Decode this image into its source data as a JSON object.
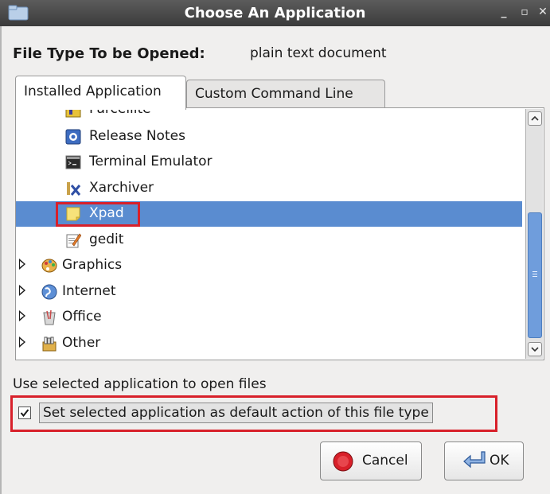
{
  "window": {
    "title": "Choose An Application",
    "minimize_glyph": "_",
    "maximize_glyph": "▫",
    "close_glyph": "✕"
  },
  "file_type": {
    "label": "File Type To be Opened:",
    "value": "plain text document"
  },
  "tabs": [
    {
      "label": "Installed Application",
      "active": true
    },
    {
      "label": "Custom Command Line",
      "active": false
    }
  ],
  "app_list": {
    "items": [
      {
        "label": "Parcellite",
        "icon": "parcellite-icon",
        "kind": "app"
      },
      {
        "label": "Release Notes",
        "icon": "release-notes-icon",
        "kind": "app"
      },
      {
        "label": "Terminal Emulator",
        "icon": "terminal-icon",
        "kind": "app"
      },
      {
        "label": "Xarchiver",
        "icon": "xarchiver-icon",
        "kind": "app"
      },
      {
        "label": "Xpad",
        "icon": "xpad-icon",
        "kind": "app",
        "selected": true
      },
      {
        "label": "gedit",
        "icon": "gedit-icon",
        "kind": "app"
      },
      {
        "label": "Graphics",
        "icon": "graphics-category-icon",
        "kind": "category"
      },
      {
        "label": "Internet",
        "icon": "internet-category-icon",
        "kind": "category"
      },
      {
        "label": "Office",
        "icon": "office-category-icon",
        "kind": "category"
      },
      {
        "label": "Other",
        "icon": "other-category-icon",
        "kind": "category"
      }
    ]
  },
  "use_selected_label": "Use selected application to open files",
  "default_checkbox": {
    "label": "Set selected application as default action of this file type",
    "checked": true,
    "glyph": "✓"
  },
  "buttons": {
    "cancel": "Cancel",
    "ok": "OK"
  },
  "colors": {
    "selection": "#5a8cd0",
    "highlight_outline": "#d8202a",
    "titlebar": "#3b3b3b",
    "scrollbar_thumb": "#6f9ddc"
  }
}
